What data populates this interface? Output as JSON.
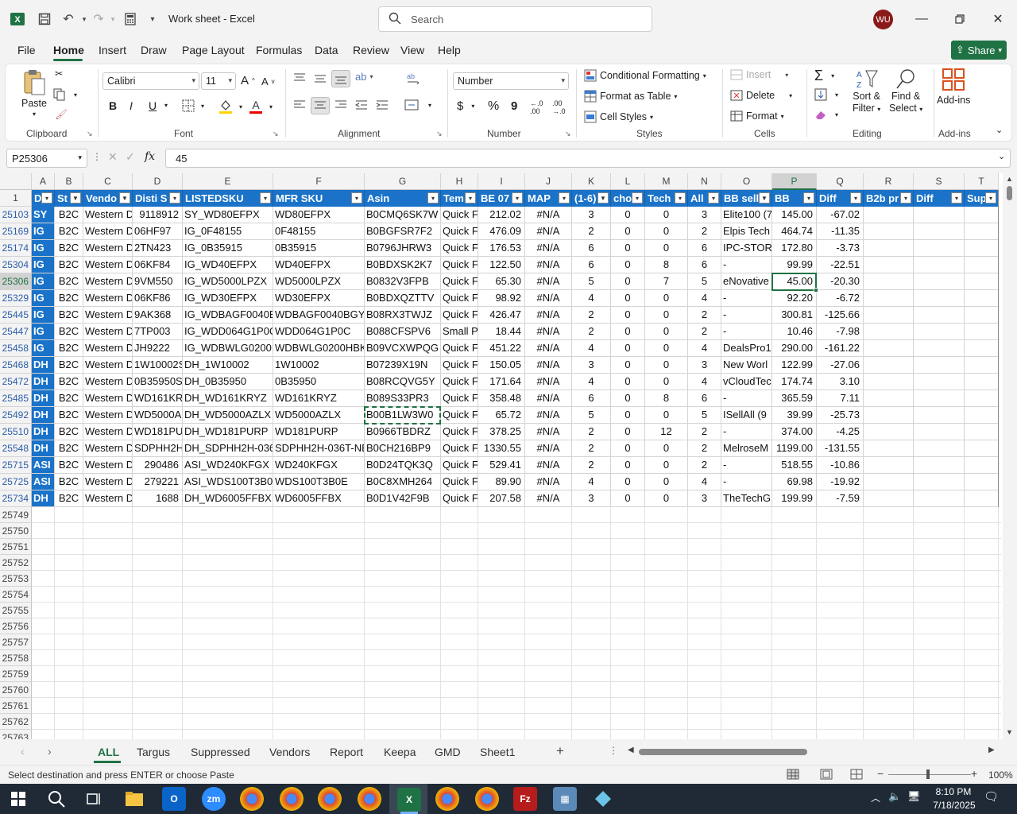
{
  "app": {
    "title": "Work sheet  -  Excel",
    "search_placeholder": "Search",
    "user_initials": "WU"
  },
  "menu": {
    "tabs": [
      "File",
      "Home",
      "Insert",
      "Draw",
      "Page Layout",
      "Formulas",
      "Data",
      "Review",
      "View",
      "Help"
    ],
    "active": "Home",
    "share_label": "Share"
  },
  "ribbon": {
    "clipboard": {
      "label": "Clipboard",
      "paste": "Paste"
    },
    "font": {
      "label": "Font",
      "name": "Calibri",
      "size": "11",
      "bold": "B",
      "italic": "I",
      "underline": "U"
    },
    "alignment": {
      "label": "Alignment"
    },
    "number": {
      "label": "Number",
      "format": "Number",
      "currency": "$",
      "percent": "%",
      "comma": "9"
    },
    "styles": {
      "label": "Styles",
      "conditional": "Conditional Formatting",
      "format_table": "Format as Table",
      "cell_styles": "Cell Styles"
    },
    "cells": {
      "label": "Cells",
      "insert": "Insert",
      "delete": "Delete",
      "format": "Format"
    },
    "editing": {
      "label": "Editing",
      "sort": "Sort &",
      "filter": "Filter",
      "find": "Find &",
      "select": "Select"
    },
    "addins": {
      "label": "Add-ins",
      "addins": "Add-ins"
    }
  },
  "formula_bar": {
    "cell_ref": "P25306",
    "fx": "fx",
    "value": "45"
  },
  "sheet": {
    "columns": [
      "A",
      "B",
      "C",
      "D",
      "E",
      "F",
      "G",
      "H",
      "I",
      "J",
      "K",
      "L",
      "M",
      "N",
      "O",
      "P",
      "Q",
      "R",
      "S",
      "T"
    ],
    "header_row_num": "1",
    "headers": [
      "D",
      "St",
      "Vendo",
      "Disti S",
      "LISTEDSKU",
      "MFR SKU",
      "Asin",
      "Tem",
      "BE 07",
      "MAP",
      "(1-6)",
      "cho",
      "Tech",
      "All",
      "BB sell",
      "BB",
      "Diff",
      "B2b pr",
      "Diff",
      "Sup"
    ],
    "rows": [
      {
        "num": "25103",
        "cells": [
          "SY",
          "B2C",
          "Western D",
          "9118912",
          "SY_WD80EFPX",
          "WD80EFPX",
          "B0CMQ6SK7W",
          "Quick F",
          "212.02",
          "#N/A",
          "3",
          "0",
          "0",
          "3",
          "Elite100 (7",
          "145.00",
          "-67.02",
          "",
          "",
          ""
        ]
      },
      {
        "num": "25169",
        "cells": [
          "IG",
          "B2C",
          "Western D",
          "06HF97",
          "IG_0F48155",
          "0F48155",
          "B0BGFSR7F2",
          "Quick F",
          "476.09",
          "#N/A",
          "2",
          "0",
          "0",
          "2",
          "Elpis Tech",
          "464.74",
          "-11.35",
          "",
          "",
          ""
        ]
      },
      {
        "num": "25174",
        "cells": [
          "IG",
          "B2C",
          "Western D",
          "2TN423",
          "IG_0B35915",
          "0B35915",
          "B0796JHRW3",
          "Quick F",
          "176.53",
          "#N/A",
          "6",
          "0",
          "0",
          "6",
          "IPC-STORE",
          "172.80",
          "-3.73",
          "",
          "",
          ""
        ]
      },
      {
        "num": "25304",
        "cells": [
          "IG",
          "B2C",
          "Western D",
          "06KF84",
          "IG_WD40EFPX",
          "WD40EFPX",
          "B0BDXSK2K7",
          "Quick F",
          "122.50",
          "#N/A",
          "6",
          "0",
          "8",
          "6",
          "-",
          "99.99",
          "-22.51",
          "",
          "",
          ""
        ]
      },
      {
        "num": "25306",
        "cells": [
          "IG",
          "B2C",
          "Western D",
          "9VM550",
          "IG_WD5000LPZX",
          "WD5000LPZX",
          "B0832V3FPB",
          "Quick F",
          "65.30",
          "#N/A",
          "5",
          "0",
          "7",
          "5",
          "eNovative",
          "45.00",
          "-20.30",
          "",
          "",
          ""
        ]
      },
      {
        "num": "25329",
        "cells": [
          "IG",
          "B2C",
          "Western D",
          "06KF86",
          "IG_WD30EFPX",
          "WD30EFPX",
          "B0BDXQZTTV",
          "Quick F",
          "98.92",
          "#N/A",
          "4",
          "0",
          "0",
          "4",
          "-",
          "92.20",
          "-6.72",
          "",
          "",
          ""
        ]
      },
      {
        "num": "25445",
        "cells": [
          "IG",
          "B2C",
          "Western D",
          "9AK368",
          "IG_WDBAGF0040B",
          "WDBAGF0040BGY-",
          "B08RX3TWJZ",
          "Quick F",
          "426.47",
          "#N/A",
          "2",
          "0",
          "0",
          "2",
          "-",
          "300.81",
          "-125.66",
          "",
          "",
          ""
        ]
      },
      {
        "num": "25447",
        "cells": [
          "IG",
          "B2C",
          "Western D",
          "7TP003",
          "IG_WDD064G1P0C",
          "WDD064G1P0C",
          "B088CFSPV6",
          "Small P",
          "18.44",
          "#N/A",
          "2",
          "0",
          "0",
          "2",
          "-",
          "10.46",
          "-7.98",
          "",
          "",
          ""
        ]
      },
      {
        "num": "25458",
        "cells": [
          "IG",
          "B2C",
          "Western D",
          "JH9222",
          "IG_WDBWLG0200H",
          "WDBWLG0200HBK",
          "B09VCXWPQG",
          "Quick F",
          "451.22",
          "#N/A",
          "4",
          "0",
          "0",
          "4",
          "DealsPro1",
          "290.00",
          "-161.22",
          "",
          "",
          ""
        ]
      },
      {
        "num": "25468",
        "cells": [
          "DH",
          "B2C",
          "Western D",
          "1W10002S",
          "DH_1W10002",
          "1W10002",
          "B07239X19N",
          "Quick F",
          "150.05",
          "#N/A",
          "3",
          "0",
          "0",
          "3",
          "New Worl",
          "122.99",
          "-27.06",
          "",
          "",
          ""
        ]
      },
      {
        "num": "25472",
        "cells": [
          "DH",
          "B2C",
          "Western D",
          "0B35950SI",
          "DH_0B35950",
          "0B35950",
          "B08RCQVG5Y",
          "Quick F",
          "171.64",
          "#N/A",
          "4",
          "0",
          "0",
          "4",
          "vCloudTec",
          "174.74",
          "3.10",
          "",
          "",
          ""
        ]
      },
      {
        "num": "25485",
        "cells": [
          "DH",
          "B2C",
          "Western D",
          "WD161KR",
          "DH_WD161KRYZ",
          "WD161KRYZ",
          "B089S33PR3",
          "Quick F",
          "358.48",
          "#N/A",
          "6",
          "0",
          "8",
          "6",
          "-",
          "365.59",
          "7.11",
          "",
          "",
          ""
        ]
      },
      {
        "num": "25492",
        "cells": [
          "DH",
          "B2C",
          "Western D",
          "WD5000A",
          "DH_WD5000AZLX",
          "WD5000AZLX",
          "B00B1LW3W0",
          "Quick F",
          "65.72",
          "#N/A",
          "5",
          "0",
          "0",
          "5",
          "ISellAll (9",
          "39.99",
          "-25.73",
          "",
          "",
          ""
        ]
      },
      {
        "num": "25510",
        "cells": [
          "DH",
          "B2C",
          "Western D",
          "WD181PU",
          "DH_WD181PURP",
          "WD181PURP",
          "B0966TBDRZ",
          "Quick F",
          "378.25",
          "#N/A",
          "2",
          "0",
          "12",
          "2",
          "-",
          "374.00",
          "-4.25",
          "",
          "",
          ""
        ]
      },
      {
        "num": "25548",
        "cells": [
          "DH",
          "B2C",
          "Western D",
          "SDPHH2H",
          "DH_SDPHH2H-036T",
          "SDPHH2H-036T-NE",
          "B0CH216BP9",
          "Quick F",
          "1330.55",
          "#N/A",
          "2",
          "0",
          "0",
          "2",
          "MelroseM",
          "1199.00",
          "-131.55",
          "",
          "",
          ""
        ]
      },
      {
        "num": "25715",
        "cells": [
          "ASI",
          "B2C",
          "Western D",
          "290486",
          "ASI_WD240KFGX",
          "WD240KFGX",
          "B0D24TQK3Q",
          "Quick F",
          "529.41",
          "#N/A",
          "2",
          "0",
          "0",
          "2",
          "-",
          "518.55",
          "-10.86",
          "",
          "",
          ""
        ]
      },
      {
        "num": "25725",
        "cells": [
          "ASI",
          "B2C",
          "Western D",
          "279221",
          "ASI_WDS100T3B0E",
          "WDS100T3B0E",
          "B0C8XMH264",
          "Quick F",
          "89.90",
          "#N/A",
          "4",
          "0",
          "0",
          "4",
          "-",
          "69.98",
          "-19.92",
          "",
          "",
          ""
        ]
      },
      {
        "num": "25734",
        "cells": [
          "DH",
          "B2C",
          "Western D",
          "1688",
          "DH_WD6005FFBX",
          "WD6005FFBX",
          "B0D1V42F9B",
          "Quick F",
          "207.58",
          "#N/A",
          "3",
          "0",
          "0",
          "3",
          "TheTechG",
          "199.99",
          "-7.59",
          "",
          "",
          ""
        ]
      }
    ],
    "empty_rows": [
      "25749",
      "25750",
      "25751",
      "25752",
      "25753",
      "25754",
      "25755",
      "25756",
      "25757",
      "25758",
      "25759",
      "25760",
      "25761",
      "25762",
      "25763"
    ]
  },
  "sheet_tabs": {
    "tabs": [
      "ALL",
      "Targus",
      "Suppressed",
      "Vendors",
      "Report",
      "Keepa",
      "GMD",
      "Sheet1"
    ],
    "active": "ALL",
    "add": "+"
  },
  "status": {
    "message": "Select destination and press ENTER or choose Paste",
    "zoom": "100%"
  },
  "taskbar": {
    "time": "8:10 PM",
    "date": "7/18/2025"
  },
  "colors": {
    "accent": "#1f7244",
    "table_header": "#1a73c9",
    "avatar": "#8b1a1a"
  }
}
